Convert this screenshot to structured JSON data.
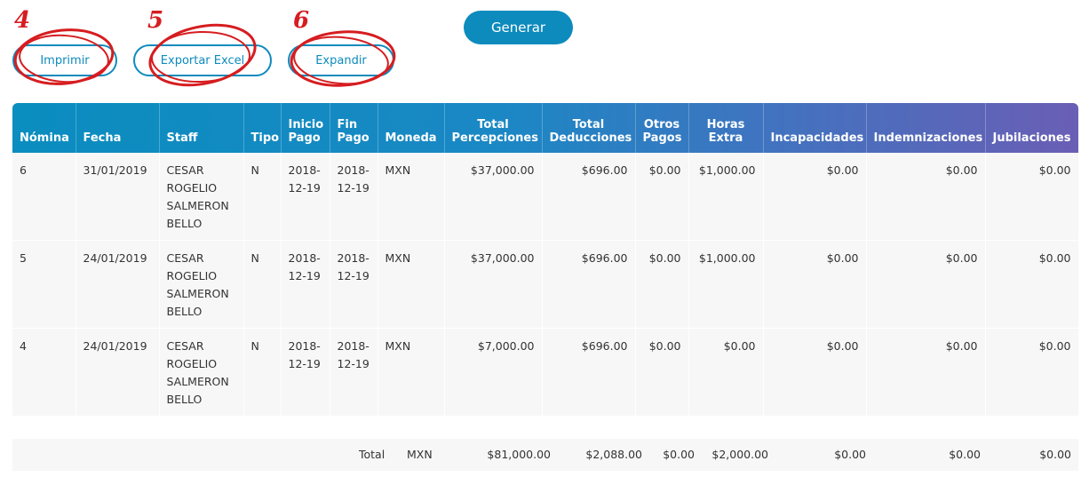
{
  "toolbar": {
    "print_label": "Imprimir",
    "excel_label": "Exportar Excel",
    "expand_label": "Expandir",
    "generate_label": "Generar"
  },
  "annotations": [
    "4",
    "5",
    "6"
  ],
  "colors": {
    "accent": "#0d8bbd",
    "annotation": "#d61d20",
    "header_start": "#0a8dbf",
    "header_end": "#6a5eb5"
  },
  "table": {
    "headers": {
      "nomina": "Nómina",
      "fecha": "Fecha",
      "staff": "Staff",
      "tipo": "Tipo",
      "inicio_1": "Inicio",
      "inicio_2": "Pago",
      "fin_1": "Fin",
      "fin_2": "Pago",
      "moneda": "Moneda",
      "percep_1": "Total",
      "percep_2": "Percepciones",
      "deduc_1": "Total",
      "deduc_2": "Deducciones",
      "otros_1": "Otros",
      "otros_2": "Pagos",
      "horas_1": "Horas",
      "horas_2": "Extra",
      "incap": "Incapacidades",
      "indem": "Indemnizaciones",
      "jubil": "Jubilaciones"
    },
    "rows": [
      {
        "nomina": "6",
        "fecha": "31/01/2019",
        "staff_1": "CESAR",
        "staff_2": "ROGELIO",
        "staff_3": "SALMERON",
        "staff_4": "BELLO",
        "tipo": "N",
        "inicio_1": "2018-",
        "inicio_2": "12-19",
        "fin_1": "2018-",
        "fin_2": "12-19",
        "moneda": "MXN",
        "percepciones": "$37,000.00",
        "deducciones": "$696.00",
        "otros": "$0.00",
        "horas": "$1,000.00",
        "incap": "$0.00",
        "indem": "$0.00",
        "jubil": "$0.00"
      },
      {
        "nomina": "5",
        "fecha": "24/01/2019",
        "staff_1": "CESAR",
        "staff_2": "ROGELIO",
        "staff_3": "SALMERON",
        "staff_4": "BELLO",
        "tipo": "N",
        "inicio_1": "2018-",
        "inicio_2": "12-19",
        "fin_1": "2018-",
        "fin_2": "12-19",
        "moneda": "MXN",
        "percepciones": "$37,000.00",
        "deducciones": "$696.00",
        "otros": "$0.00",
        "horas": "$1,000.00",
        "incap": "$0.00",
        "indem": "$0.00",
        "jubil": "$0.00"
      },
      {
        "nomina": "4",
        "fecha": "24/01/2019",
        "staff_1": "CESAR",
        "staff_2": "ROGELIO",
        "staff_3": "SALMERON",
        "staff_4": "BELLO",
        "tipo": "N",
        "inicio_1": "2018-",
        "inicio_2": "12-19",
        "fin_1": "2018-",
        "fin_2": "12-19",
        "moneda": "MXN",
        "percepciones": "$7,000.00",
        "deducciones": "$696.00",
        "otros": "$0.00",
        "horas": "$0.00",
        "incap": "$0.00",
        "indem": "$0.00",
        "jubil": "$0.00"
      }
    ],
    "total": {
      "label": "Total",
      "moneda": "MXN",
      "percepciones": "$81,000.00",
      "deducciones": "$2,088.00",
      "otros": "$0.00",
      "horas": "$2,000.00",
      "incap": "$0.00",
      "indem": "$0.00",
      "jubil": "$0.00"
    }
  }
}
